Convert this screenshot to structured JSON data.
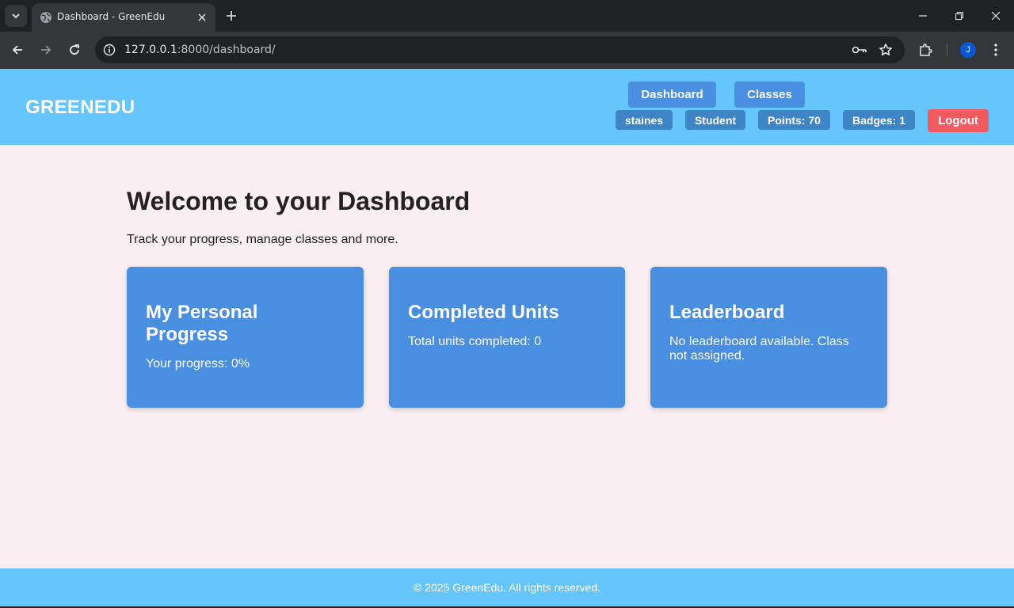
{
  "browser": {
    "tab_title": "Dashboard - GreenEdu",
    "url_host": "127.0.0.1",
    "url_rest": ":8000/dashboard/",
    "profile_initial": "J"
  },
  "header": {
    "brand": "GREENEDU",
    "nav": [
      "Dashboard",
      "Classes"
    ],
    "user": {
      "username": "staines",
      "role": "Student",
      "points": "Points: 70",
      "badges": "Badges: 1"
    },
    "logout_label": "Logout"
  },
  "main": {
    "title": "Welcome to your Dashboard",
    "subtitle": "Track your progress, manage classes and more.",
    "cards": [
      {
        "title": "My Personal Progress",
        "text": "Your progress: 0%"
      },
      {
        "title": "Completed Units",
        "text": "Total units completed: 0"
      },
      {
        "title": "Leaderboard",
        "text": "No leaderboard available. Class not assigned."
      }
    ]
  },
  "footer": {
    "text": "© 2025 GreenEdu. All rights reserved."
  },
  "colors": {
    "header_bg": "#66c5fd",
    "card_bg": "#4a8ee0",
    "pill_bg": "#3d85c6",
    "logout_bg": "#f15a5f",
    "page_bg": "#f9eff3"
  }
}
